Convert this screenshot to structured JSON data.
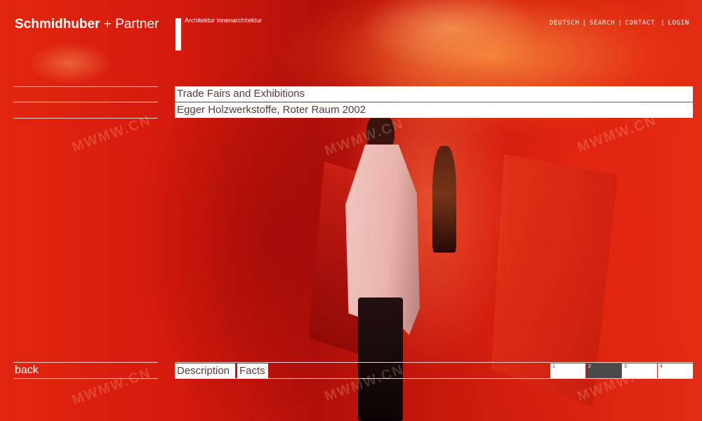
{
  "brand": {
    "name_bold": "Schmidhuber",
    "plus": "+",
    "name_regular": "Partner",
    "tagline": "Architektur  Innenarchitektur"
  },
  "topnav": {
    "items": [
      "DEUTSCH",
      "SEARCH",
      "CONTACT",
      "LOGIN"
    ],
    "separator": "|"
  },
  "main": {
    "category": "Trade Fairs and Exhibitions",
    "project": "Egger Holzwerkstoffe, Roter Raum 2002"
  },
  "bottom": {
    "back_label": "back",
    "tabs": [
      "Description",
      "Facts"
    ],
    "pages": [
      "1",
      "2",
      "3",
      "4"
    ],
    "active_page": "2"
  },
  "watermark": "MWMW.CN",
  "colors": {
    "background": "#c8180c",
    "line": "#f2d2cc",
    "title_text": "#5a3a36",
    "active_page": "#4a4a4a"
  }
}
